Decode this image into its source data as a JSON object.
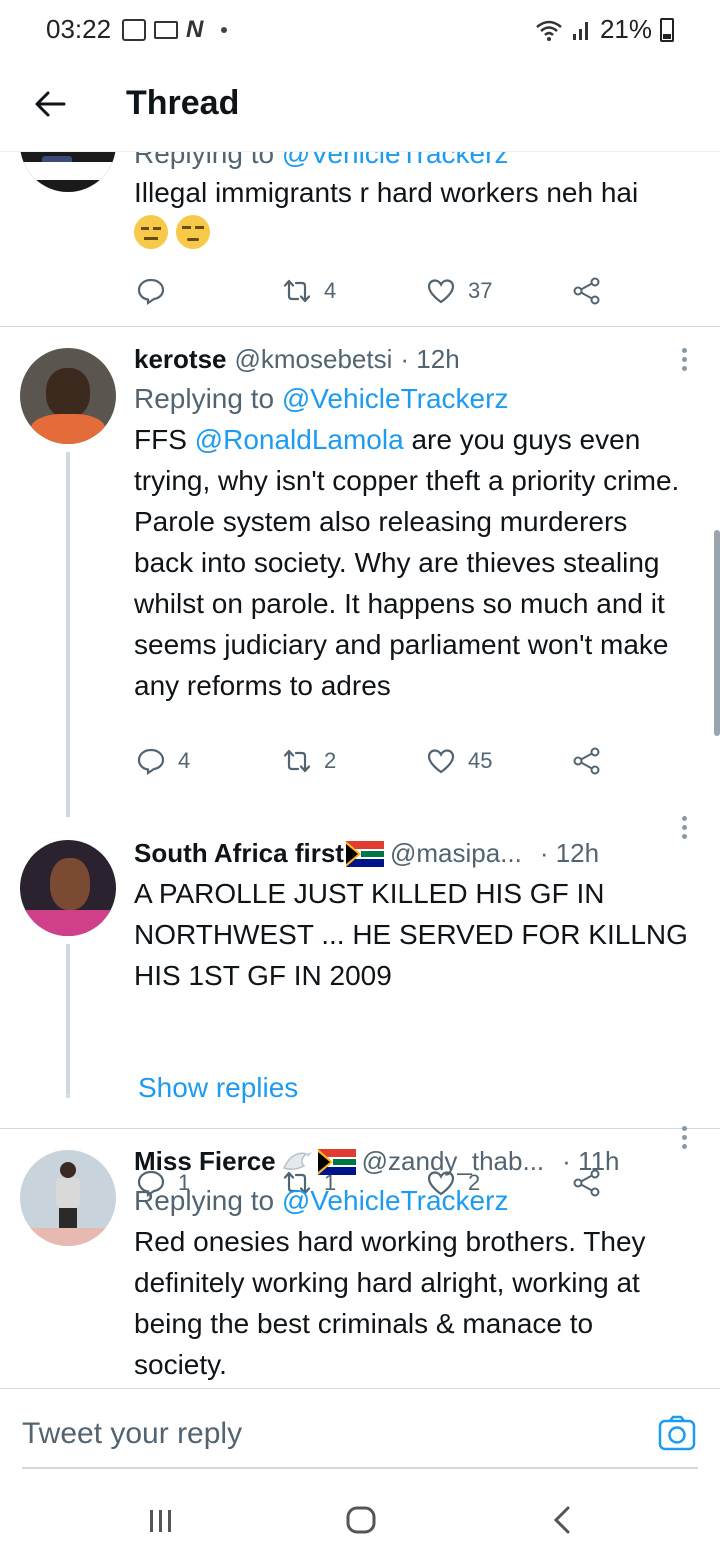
{
  "status_bar": {
    "time": "03:22",
    "battery": "21%"
  },
  "header": {
    "title": "Thread"
  },
  "tweets": [
    {
      "replying_to_label": "Replying to",
      "replying_to_handle": "@VehicleTrackerz",
      "text": "Illegal immigrants  r hard workers neh hai",
      "emojis": [
        "expressionless-face-emoji",
        "unamused-face-emoji"
      ],
      "replies": "",
      "retweets": "4",
      "likes": "37"
    },
    {
      "name": "kerotse",
      "handle": "@kmosebetsi",
      "time": "· 12h",
      "replying_to_label": "Replying to",
      "replying_to_handle": "@VehicleTrackerz",
      "text_prefix": "FFS ",
      "text_mention": "@RonaldLamola",
      "text_rest": " are you guys even trying, why isn't copper theft a priority crime.  Parole system also releasing murderers back into society. Why are thieves stealing whilst on parole. It happens so much and it seems judiciary and parliament won't make any reforms to adres",
      "replies": "4",
      "retweets": "2",
      "likes": "45"
    },
    {
      "name": "South Africa first",
      "handle": "@masipa...",
      "time": "· 12h",
      "text": "A PAROLLE JUST KILLED HIS GF IN NORTHWEST ... HE SERVED FOR KILLNG HIS 1ST GF IN 2009",
      "replies": "1",
      "retweets": "1",
      "likes": "2"
    },
    {
      "name": "Miss Fierce",
      "handle": "@zandy_thab...",
      "time": "· 11h",
      "replying_to_label": "Replying to",
      "replying_to_handle": "@VehicleTrackerz",
      "text": "Red onesies hard working brothers. They definitely working hard alright,   working at being the best criminals & manace to society."
    }
  ],
  "show_replies": "Show replies",
  "compose": {
    "placeholder": "Tweet your reply"
  },
  "colors": {
    "accent": "#1d9bf0",
    "text": "#0f1419",
    "secondary": "#536471",
    "divider": "#cfd9de"
  }
}
